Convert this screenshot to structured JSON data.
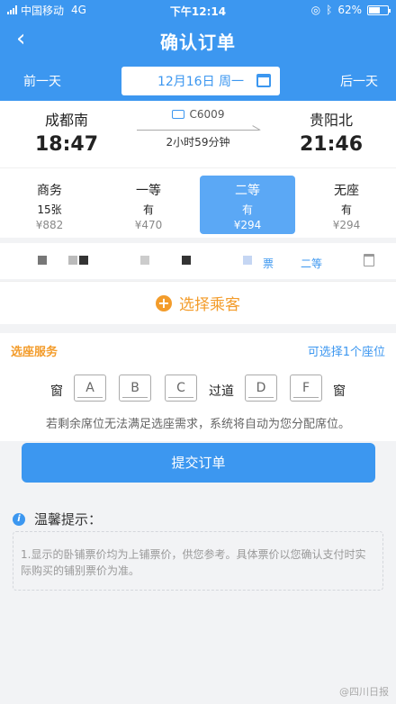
{
  "status": {
    "carrier": "中国移动",
    "network": "4G",
    "time": "下午12:14",
    "battery": "62%",
    "battery_level": 0.62
  },
  "nav": {
    "title": "确认订单"
  },
  "daybar": {
    "prev": "前一天",
    "date": "12月16日 周一",
    "next": "后一天"
  },
  "train": {
    "from_station": "成都南",
    "from_time": "18:47",
    "train_no": "C6009",
    "duration": "2小时59分钟",
    "to_station": "贵阳北",
    "to_time": "21:46"
  },
  "seats": [
    {
      "name": "商务",
      "count": "15张",
      "price": "¥882"
    },
    {
      "name": "一等",
      "count": "有",
      "price": "¥470"
    },
    {
      "name": "二等",
      "count": "有",
      "price": "¥294"
    },
    {
      "name": "无座",
      "count": "有",
      "price": "¥294"
    }
  ],
  "passenger": {
    "ticket_type": "票",
    "seat_class": "二等"
  },
  "add_passenger": "选择乘客",
  "seat_selection": {
    "title": "选座服务",
    "hint": "可选择1个座位",
    "window_left": "窗",
    "aisle": "过道",
    "window_right": "窗",
    "seats": [
      "A",
      "B",
      "C",
      "D",
      "F"
    ],
    "note": "若剩余席位无法满足选座需求，系统将自动为您分配席位。"
  },
  "submit": "提交订单",
  "tips": {
    "title": "温馨提示：",
    "text": "1.显示的卧铺票价均为上铺票价，供您参考。具体票价以您确认支付时实际购买的铺别票价为准。"
  },
  "watermark": "@四川日报"
}
